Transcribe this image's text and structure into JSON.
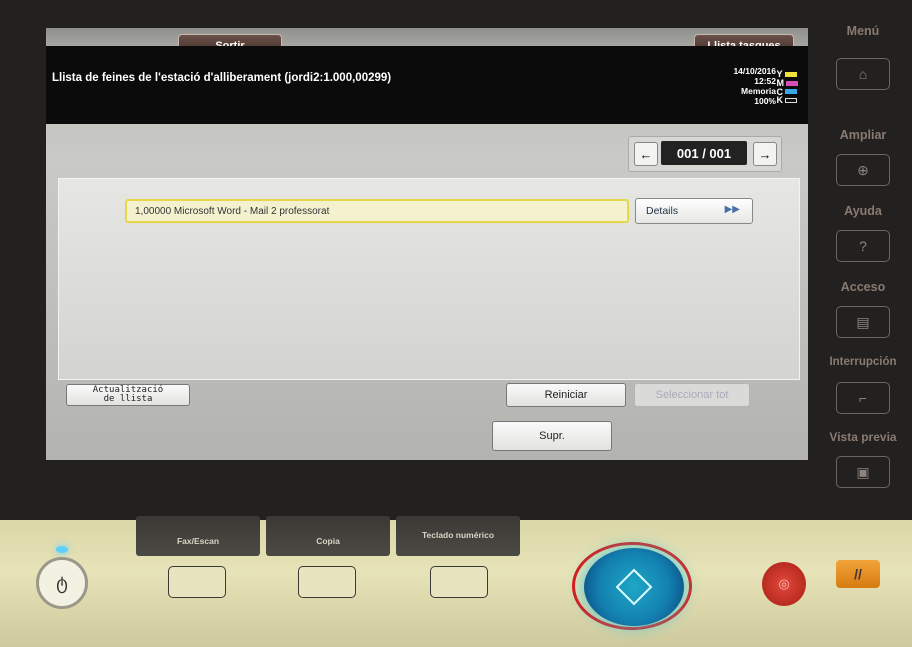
{
  "screen": {
    "tabs": {
      "exit": "Sortir",
      "jobs_list": "Llista tasques"
    },
    "title": "Llista de feines de l'estació d'alliberament (jordi2:1.000,00299)",
    "status": {
      "date": "14/10/2016",
      "time": "12:52",
      "memory_label": "Memoria",
      "memory_value": "100%"
    },
    "toner": [
      {
        "letter": "Y",
        "color": "#f1e23a"
      },
      {
        "letter": "M",
        "color": "#d64fb9"
      },
      {
        "letter": "C",
        "color": "#3aa8e8"
      },
      {
        "letter": "K",
        "color": "#111111"
      }
    ],
    "pager": {
      "prev": "←",
      "page": "001 / 001",
      "next": "→"
    },
    "jobs": [
      {
        "name": "1,00000 Microsoft Word - Mail 2 professorat"
      }
    ],
    "details_button": "Details",
    "details_chevron": "▶▶",
    "refresh_button_line1": "Actualització",
    "refresh_button_line2": "de llista",
    "reset_button": "Reiniciar",
    "select_all_button": "Seleccionar tot",
    "delete_button": "Supr."
  },
  "sidebar": {
    "menu": "Menú",
    "zoom": "Ampliar",
    "help": "Ayuda",
    "help_symbol": "?",
    "access": "Acceso",
    "interrupt": "Interrupción",
    "preview": "Vista previa"
  },
  "panel": {
    "fax_scan": "Fax/Escan",
    "copy": "Copia",
    "keypad": "Teclado numérico"
  }
}
